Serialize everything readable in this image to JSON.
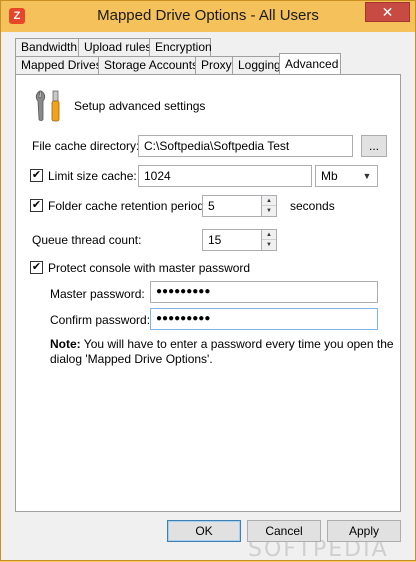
{
  "window": {
    "title": "Mapped Drive Options - All Users",
    "close_glyph": "✕",
    "app_icon_letter": "Z"
  },
  "tabs": {
    "back_row": [
      "Bandwidth",
      "Upload rules",
      "Encryption"
    ],
    "front_row": [
      "Mapped Drives",
      "Storage Accounts",
      "Proxy",
      "Logging",
      "Advanced"
    ],
    "active": "Advanced"
  },
  "panel": {
    "header": "Setup advanced settings",
    "file_cache_label": "File cache directory:",
    "file_cache_value": "C:\\Softpedia\\Softpedia Test",
    "browse_label": "...",
    "limit_cache_label": "Limit size cache:",
    "limit_cache_checked": true,
    "limit_cache_value": "1024",
    "limit_cache_unit": "Mb",
    "folder_retention_label": "Folder cache retention period:",
    "folder_retention_checked": true,
    "folder_retention_value": "5",
    "folder_retention_unit": "seconds",
    "queue_label": "Queue thread count:",
    "queue_value": "15",
    "protect_label": "Protect console with master password",
    "protect_checked": true,
    "master_label": "Master password:",
    "master_value": "●●●●●●●●●",
    "confirm_label": "Confirm password:",
    "confirm_value": "●●●●●●●●●",
    "note_bold": "Note:",
    "note_text": "You will have to enter a password every time you open the",
    "note_text2": "dialog 'Mapped Drive Options'."
  },
  "buttons": {
    "ok": "OK",
    "cancel": "Cancel",
    "apply": "Apply"
  },
  "watermark": "SOFTPEDIA",
  "icons": {
    "wrench": "wrench-icon",
    "check": "✔",
    "spin_up": "▲",
    "spin_down": "▼",
    "dropdown": "▼"
  }
}
